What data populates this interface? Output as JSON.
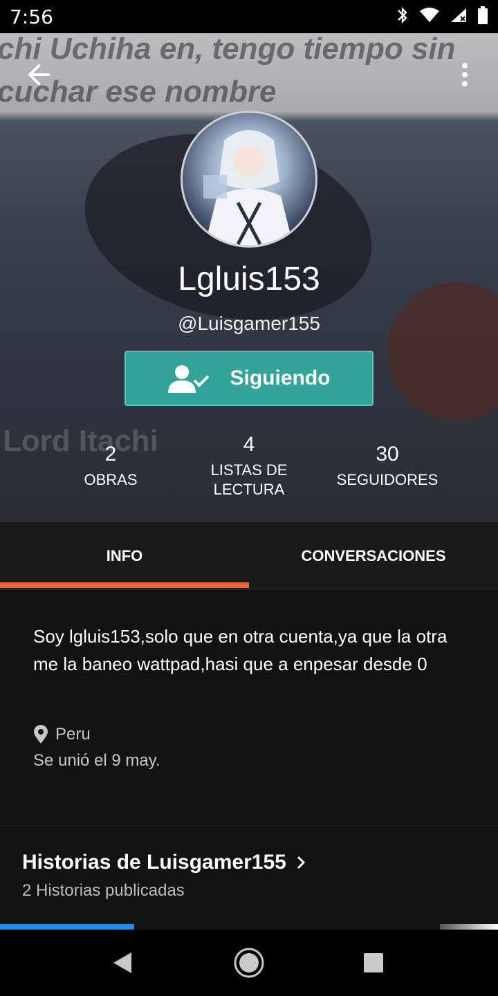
{
  "status_bar": {
    "time": "7:56"
  },
  "header": {
    "background_text_line1": "chi Uchiha en, tengo tiempo sin",
    "background_text_line2": "cuchar ese nombre",
    "watermark": "Lord Itachi"
  },
  "profile": {
    "display_name": "Lgluis153",
    "username": "@Luisgamer155",
    "follow_button_label": "Siguiendo"
  },
  "stats": [
    {
      "value": "2",
      "label_line1": "OBRAS",
      "label_line2": ""
    },
    {
      "value": "4",
      "label_line1": "LISTAS DE",
      "label_line2": "LECTURA"
    },
    {
      "value": "30",
      "label_line1": "SEGUIDORES",
      "label_line2": ""
    }
  ],
  "tabs": {
    "info": "INFO",
    "conversations": "CONVERSACIONES",
    "active": "INFO"
  },
  "about": {
    "bio": "Soy lgluis153,solo que en otra cuenta,ya que la otra me la baneo wattpad,hasi que a enpesar desde 0",
    "location": "Peru",
    "joined": "Se unió el 9 may."
  },
  "stories": {
    "title": "Historias de Luisgamer155",
    "subtitle": "2 Historias publicadas"
  },
  "colors": {
    "accent_teal": "#34a39a",
    "tab_indicator": "#f26431",
    "progress_blue": "#1e8cf0"
  }
}
